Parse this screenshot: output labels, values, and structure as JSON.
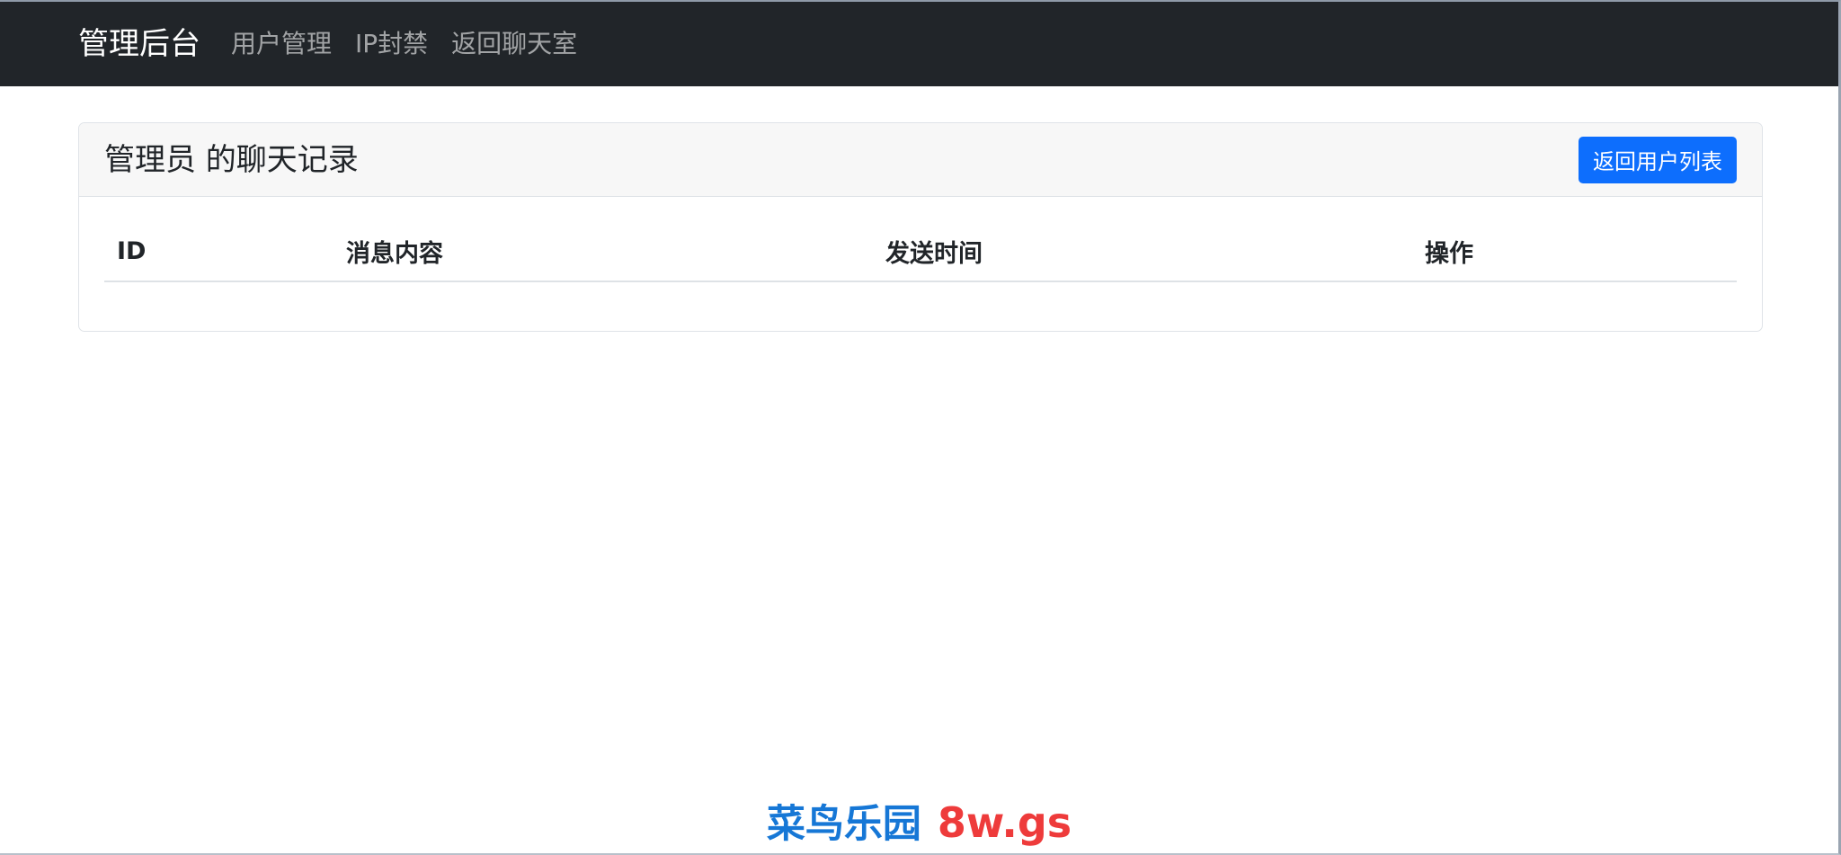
{
  "navbar": {
    "brand": "管理后台",
    "links": [
      {
        "label": "用户管理"
      },
      {
        "label": "IP封禁"
      },
      {
        "label": "返回聊天室"
      }
    ]
  },
  "card": {
    "title": "管理员 的聊天记录",
    "back_button": "返回用户列表",
    "table": {
      "headers": [
        "ID",
        "消息内容",
        "发送时间",
        "操作"
      ],
      "rows": []
    }
  },
  "watermark": {
    "cn": "菜鸟乐园",
    "site": "8w.gs"
  },
  "colors": {
    "navbar_bg": "#212529",
    "primary": "#0d6efd",
    "watermark_blue": "#1677d6",
    "watermark_red": "#ee3b3b"
  }
}
